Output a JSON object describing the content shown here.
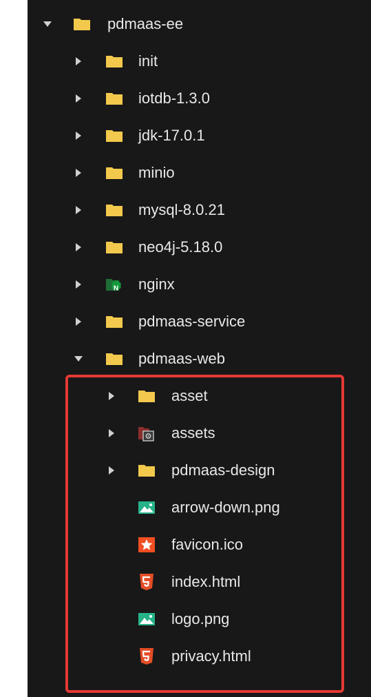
{
  "tree": {
    "root": {
      "label": "pdmaas-ee",
      "expanded": true
    },
    "children": [
      {
        "label": "init",
        "icon": "folder-icon"
      },
      {
        "label": "iotdb-1.3.0",
        "icon": "folder-icon"
      },
      {
        "label": "jdk-17.0.1",
        "icon": "folder-icon"
      },
      {
        "label": "minio",
        "icon": "folder-icon"
      },
      {
        "label": "mysql-8.0.21",
        "icon": "folder-icon"
      },
      {
        "label": "neo4j-5.18.0",
        "icon": "folder-icon"
      },
      {
        "label": "nginx",
        "icon": "nginx-folder-icon"
      },
      {
        "label": "pdmaas-service",
        "icon": "folder-icon"
      },
      {
        "label": "pdmaas-web",
        "icon": "folder-icon",
        "expanded": true
      }
    ],
    "web_children": [
      {
        "label": "asset",
        "icon": "folder-icon"
      },
      {
        "label": "assets",
        "icon": "assets-folder-icon"
      },
      {
        "label": "pdmaas-design",
        "icon": "folder-icon"
      },
      {
        "label": "arrow-down.png",
        "icon": "image-file-icon"
      },
      {
        "label": "favicon.ico",
        "icon": "favicon-file-icon"
      },
      {
        "label": "index.html",
        "icon": "html5-file-icon"
      },
      {
        "label": "logo.png",
        "icon": "image-file-icon"
      },
      {
        "label": "privacy.html",
        "icon": "html5-file-icon"
      }
    ]
  },
  "colors": {
    "background": "#181818",
    "text": "#e8e8e8",
    "folder": "#f2c94c",
    "highlight_border": "#e53935",
    "image_icon": "#26b38a",
    "html_icon": "#e44d26",
    "favicon_icon": "#f04e23",
    "nginx_icon": "#139a3c"
  }
}
